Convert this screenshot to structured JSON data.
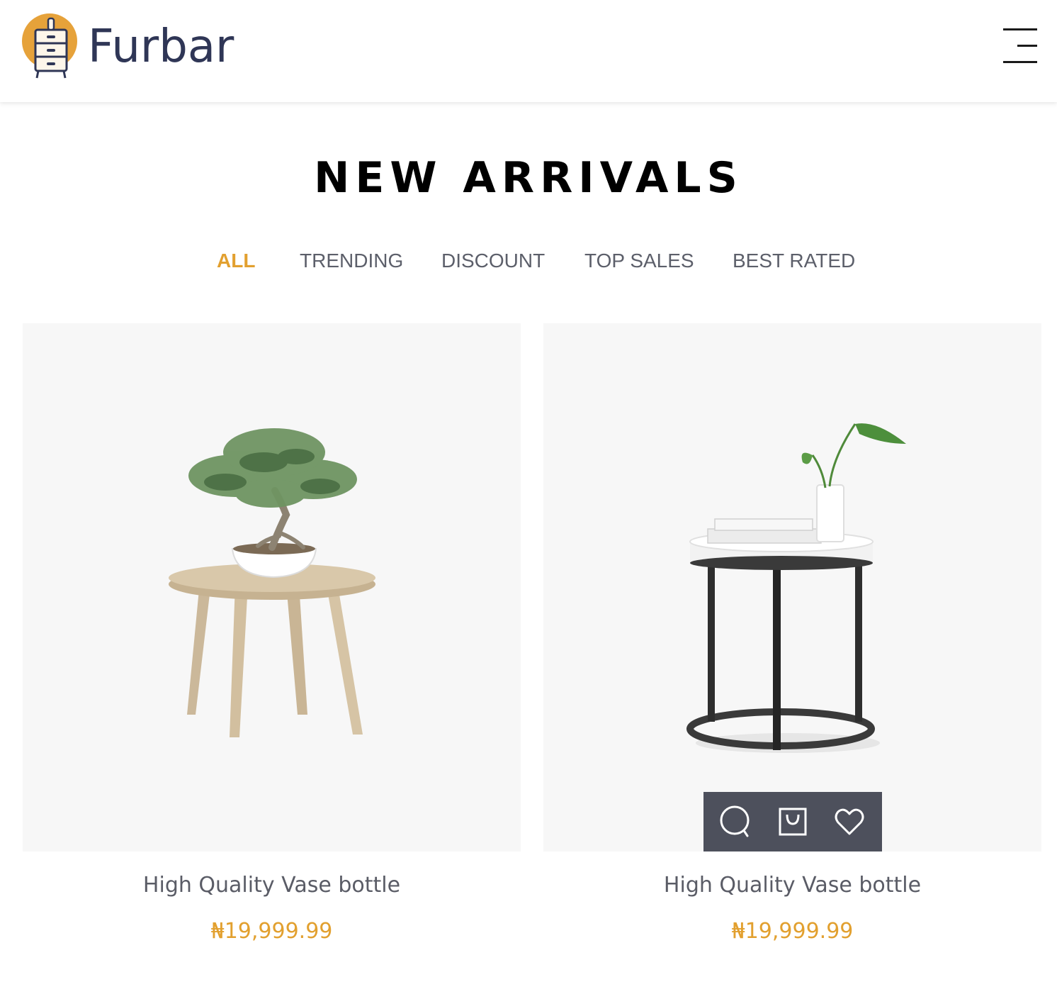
{
  "header": {
    "brand": "Furbar",
    "menu_icon": "menu-icon"
  },
  "section": {
    "title": "NEW ARRIVALS"
  },
  "tabs": [
    {
      "label": "ALL",
      "active": true
    },
    {
      "label": "TRENDING",
      "active": false
    },
    {
      "label": "DISCOUNT",
      "active": false
    },
    {
      "label": "TOP SALES",
      "active": false
    },
    {
      "label": "BEST RATED",
      "active": false
    }
  ],
  "products": [
    {
      "title": "High Quality Vase bottle",
      "price": "₦19,999.99",
      "image": "wooden-side-table-with-bonsai"
    },
    {
      "title": "High Quality Vase bottle",
      "price": "₦19,999.99",
      "image": "black-metal-side-table-with-vase"
    }
  ],
  "card_actions": [
    {
      "icon": "search-icon"
    },
    {
      "icon": "shopping-bag-icon"
    },
    {
      "icon": "heart-icon"
    }
  ],
  "colors": {
    "accent": "#e2a02f",
    "brand_text": "#2f3656",
    "action_bar": "#4d505c",
    "card_bg": "#f7f7f7"
  }
}
